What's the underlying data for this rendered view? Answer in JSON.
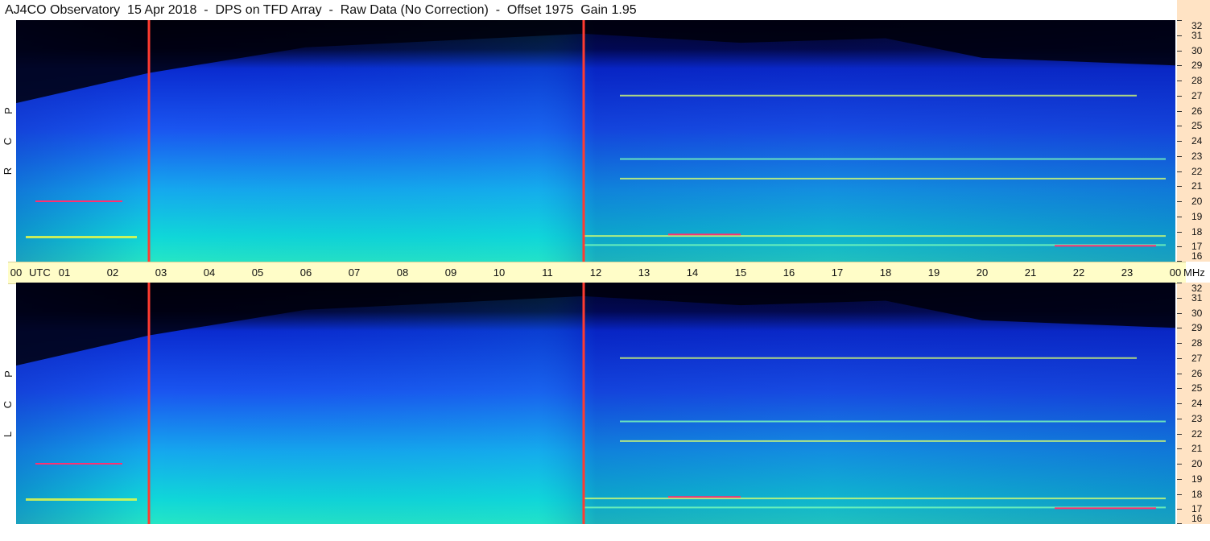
{
  "title": "AJ4CO Observatory  15 Apr 2018  -  DPS on TFD Array  -  Raw Data (No Correction)  -  Offset 1975  Gain 1.95",
  "panels": [
    {
      "id": "rcp",
      "letters": [
        "P",
        "C",
        "R"
      ]
    },
    {
      "id": "lcp",
      "letters": [
        "P",
        "C",
        "L"
      ]
    }
  ],
  "colors": {
    "background_freq_axis": "#ffe3c4",
    "time_axis_bg": "#fffdc8",
    "marker_line": "#ff3b30",
    "spectrum_low": "#000010",
    "spectrum_mid": "#1840f0",
    "spectrum_high": "#00e0d8",
    "rfi_line": "#f0ff60"
  },
  "chart_data": {
    "type": "heatmap",
    "subtype": "dynamic spectrogram (time vs frequency)",
    "x_axis": {
      "unit_label": "UTC",
      "tick_labels": [
        "00",
        "01",
        "02",
        "03",
        "04",
        "05",
        "06",
        "07",
        "08",
        "09",
        "10",
        "11",
        "12",
        "13",
        "14",
        "15",
        "16",
        "17",
        "18",
        "19",
        "20",
        "21",
        "22",
        "23",
        "00"
      ],
      "range_hours": [
        0,
        24
      ]
    },
    "y_axis": {
      "unit_label": "MHz",
      "tick_labels": [
        "16",
        "17",
        "18",
        "19",
        "20",
        "21",
        "22",
        "23",
        "24",
        "25",
        "26",
        "27",
        "28",
        "29",
        "30",
        "31",
        "32"
      ],
      "range_mhz": [
        16,
        32
      ]
    },
    "panels": [
      "RCP",
      "LCP"
    ],
    "vertical_markers_utc_hours": [
      2.75,
      11.75
    ],
    "night_boundary_utc_hours": [
      0,
      2.75
    ],
    "persistent_interference_mhz": [
      17.1,
      17.7,
      20.0,
      21.5,
      22.8,
      27.0
    ],
    "colormap": "black-blue-cyan-yellow-red"
  }
}
